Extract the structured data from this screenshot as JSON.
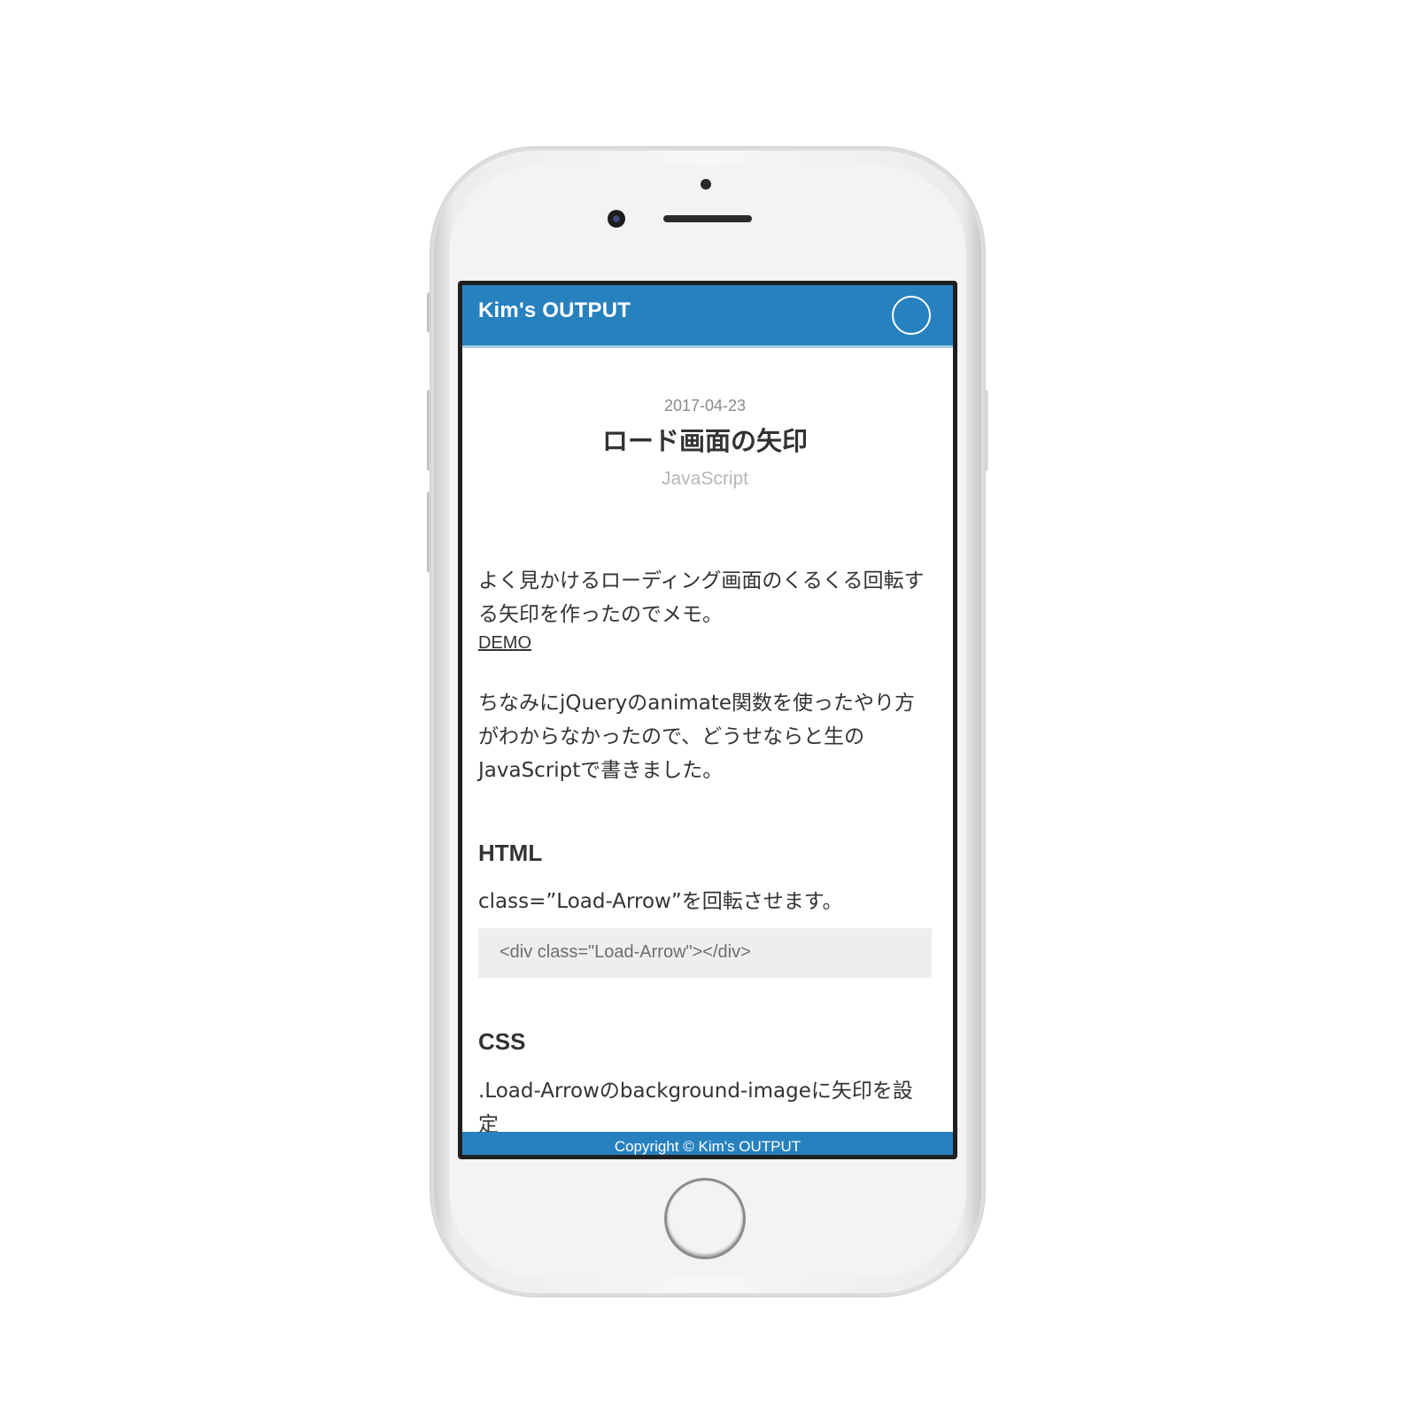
{
  "header": {
    "site_title": "Kim's OUTPUT"
  },
  "post": {
    "date": "2017-04-23",
    "title": "ロード画面の矢印",
    "category": "JavaScript",
    "intro": "よく見かけるローディング画面のくるくる回転する矢印を作ったのでメモ。",
    "demo_link": "DEMO",
    "note": "ちなみにjQueryのanimate関数を使ったやり方がわからなかったので、どうせならと生のJavaScriptで書きました。"
  },
  "sections": {
    "html": {
      "heading": "HTML",
      "text": "class=”Load-Arrow”を回転させます。",
      "code": "<div class=\"Load-Arrow\"></div>"
    },
    "css": {
      "heading": "CSS",
      "text": ".Load-Arrowのbackground-imageに矢印を設定"
    }
  },
  "footer": {
    "copyright": "Copyright © Kim's OUTPUT"
  },
  "colors": {
    "brand": "#2781bf",
    "text": "#333333",
    "code_bg": "#eeeeee"
  }
}
